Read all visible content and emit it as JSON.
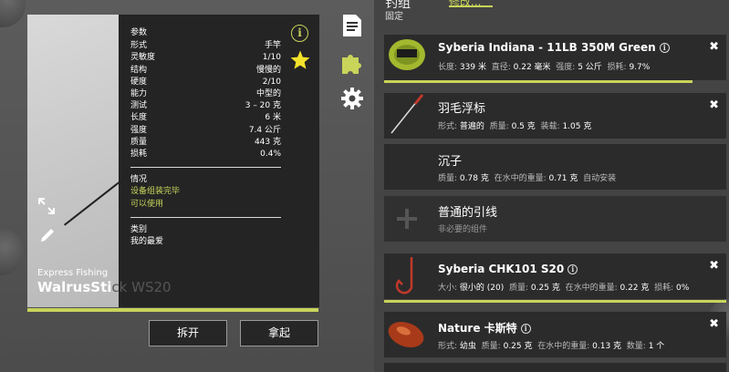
{
  "rod": {
    "brand": "Express Fishing",
    "name_main": "WalrusSti",
    "name_ghost": "ck WS20",
    "params_title": "参数",
    "params": [
      {
        "label": "形式",
        "value": "手竿"
      },
      {
        "label": "灵敏度",
        "value": "1/10"
      },
      {
        "label": "结构",
        "value": "慢慢的"
      },
      {
        "label": "硬度",
        "value": "2/10"
      },
      {
        "label": "能力",
        "value": "中型的"
      },
      {
        "label": "测试",
        "value": "3 – 20 克"
      },
      {
        "label": "长度",
        "value": "6 米"
      },
      {
        "label": "强度",
        "value": "7.4 公斤"
      },
      {
        "label": "质量",
        "value": "443 克"
      },
      {
        "label": "损耗",
        "value": "0.4%"
      }
    ],
    "status_title": "情况",
    "status_lines": [
      "设备组装完毕",
      "可以使用"
    ],
    "category_title": "类别",
    "category_value": "我的最爱",
    "info_icon": "i"
  },
  "buttons": {
    "unpack": "拆开",
    "pickup": "拿起"
  },
  "list_header": {
    "title": "钓组",
    "link": "修改...",
    "subtitle": "固定"
  },
  "items": [
    {
      "name": "Syberia Indiana - 11LB 350M Green",
      "details": [
        [
          "长度:",
          "339 米"
        ],
        [
          "直径:",
          "0.22 毫米"
        ],
        [
          "强度:",
          "5 公斤"
        ],
        [
          "损耗:",
          "9.7%"
        ]
      ],
      "closable": true
    },
    {
      "name": "羽毛浮标",
      "details": [
        [
          "形式:",
          "普遍的"
        ],
        [
          "质量:",
          "0.5 克"
        ],
        [
          "装载:",
          "1.05 克"
        ]
      ],
      "closable": true
    },
    {
      "name": "沉子",
      "details": [
        [
          "质量:",
          "0.78 克"
        ],
        [
          "在水中的重量:",
          "0.71 克"
        ],
        [
          "",
          "自动安装"
        ]
      ],
      "closable": false
    },
    {
      "name": "普通的引线",
      "details": [
        [
          "",
          "非必要的组件"
        ]
      ],
      "closable": false
    },
    {
      "name": "Syberia CHK101 S20",
      "details": [
        [
          "大小:",
          "很小的 (20)"
        ],
        [
          "质量:",
          "0.25 克"
        ],
        [
          "在水中的重量:",
          "0.22 克"
        ],
        [
          "损耗:",
          "0%"
        ]
      ],
      "closable": true
    },
    {
      "name": "Nature 卡斯特",
      "details": [
        [
          "形式:",
          "幼虫"
        ],
        [
          "质量:",
          "0.25 克"
        ],
        [
          "在水中的重量:",
          "0.13 克"
        ],
        [
          "数量:",
          "1 个"
        ]
      ],
      "closable": true
    }
  ],
  "close_glyph": "✖",
  "line_wear_fraction": 0.9,
  "colors": {
    "accent": "#c8d45a",
    "panel": "#242424"
  }
}
